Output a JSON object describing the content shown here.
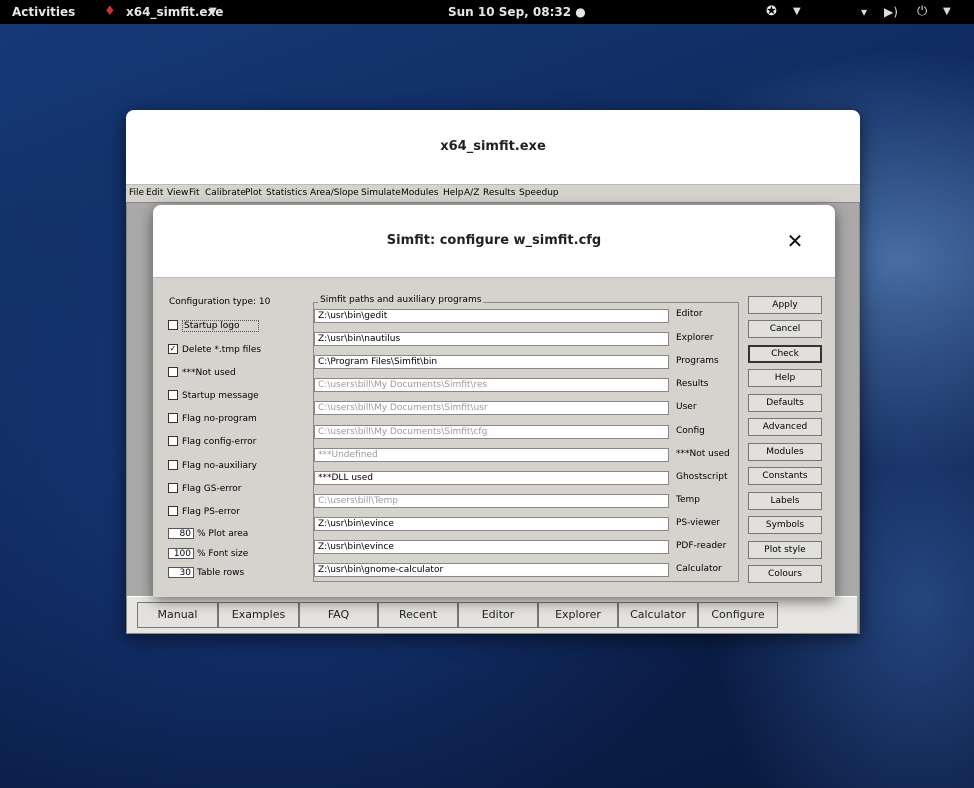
{
  "topbar": {
    "activities": "Activities",
    "app_name": "x64_simfit.exe",
    "clock": "Sun 10 Sep, 08:32 ●",
    "icons": [
      "wine-icon",
      "accessibility-icon",
      "wifi-icon",
      "volume-icon",
      "power-icon"
    ]
  },
  "app": {
    "title": "x64_simfit.exe",
    "menu": [
      "File",
      "Edit",
      "View",
      "Fit",
      "Calibrate",
      "Plot",
      "Statistics",
      "Area/Slope",
      "Simulate",
      "Modules",
      "Help",
      "A/Z",
      "Results",
      "Speedup"
    ],
    "taskbar": [
      "Manual",
      "Examples",
      "FAQ",
      "Recent",
      "Editor",
      "Explorer",
      "Calculator",
      "Configure"
    ]
  },
  "dialog": {
    "title": "Simfit: configure w_simfit.cfg",
    "config_type": "Configuration type: 10",
    "options": [
      {
        "label": "Startup logo",
        "checked": false
      },
      {
        "label": "Delete *.tmp files",
        "checked": true
      },
      {
        "label": "***Not used",
        "checked": false
      },
      {
        "label": "Startup message",
        "checked": false
      },
      {
        "label": "Flag no-program",
        "checked": false
      },
      {
        "label": "Flag config-error",
        "checked": false
      },
      {
        "label": "Flag no-auxiliary",
        "checked": false
      },
      {
        "label": "Flag GS-error",
        "checked": false
      },
      {
        "label": "Flag PS-error",
        "checked": false
      }
    ],
    "numbers": [
      {
        "value": "80",
        "label": "% Plot area"
      },
      {
        "value": "100",
        "label": "% Font size"
      },
      {
        "value": "30",
        "label": "Table rows"
      }
    ],
    "group_title": "Simfit paths and auxiliary programs",
    "paths": [
      {
        "value": "Z:\\usr\\bin\\gedit",
        "label": "Editor",
        "enabled": true
      },
      {
        "value": "Z:\\usr\\bin\\nautilus",
        "label": "Explorer",
        "enabled": true
      },
      {
        "value": "C:\\Program Files\\Simfit\\bin",
        "label": "Programs",
        "enabled": true
      },
      {
        "value": "C:\\users\\bill\\My Documents\\Simfit\\res",
        "label": "Results",
        "enabled": false
      },
      {
        "value": "C:\\users\\bill\\My Documents\\Simfit\\usr",
        "label": "User",
        "enabled": false
      },
      {
        "value": "C:\\users\\bill\\My Documents\\Simfit\\cfg",
        "label": "Config",
        "enabled": false
      },
      {
        "value": "***Undefined",
        "label": "***Not used",
        "enabled": false
      },
      {
        "value": "***DLL used",
        "label": "Ghostscript",
        "enabled": true
      },
      {
        "value": "C:\\users\\bill\\Temp",
        "label": "Temp",
        "enabled": false
      },
      {
        "value": "Z:\\usr\\bin\\evince",
        "label": "PS-viewer",
        "enabled": true
      },
      {
        "value": "Z:\\usr\\bin\\evince",
        "label": "PDF-reader",
        "enabled": true
      },
      {
        "value": "Z:\\usr\\bin\\gnome-calculator",
        "label": "Calculator",
        "enabled": true
      }
    ],
    "buttons": [
      "Apply",
      "Cancel",
      "Check",
      "Help",
      "Defaults",
      "Advanced",
      "Modules",
      "Constants",
      "Labels",
      "Symbols",
      "Plot style",
      "Colours"
    ]
  }
}
